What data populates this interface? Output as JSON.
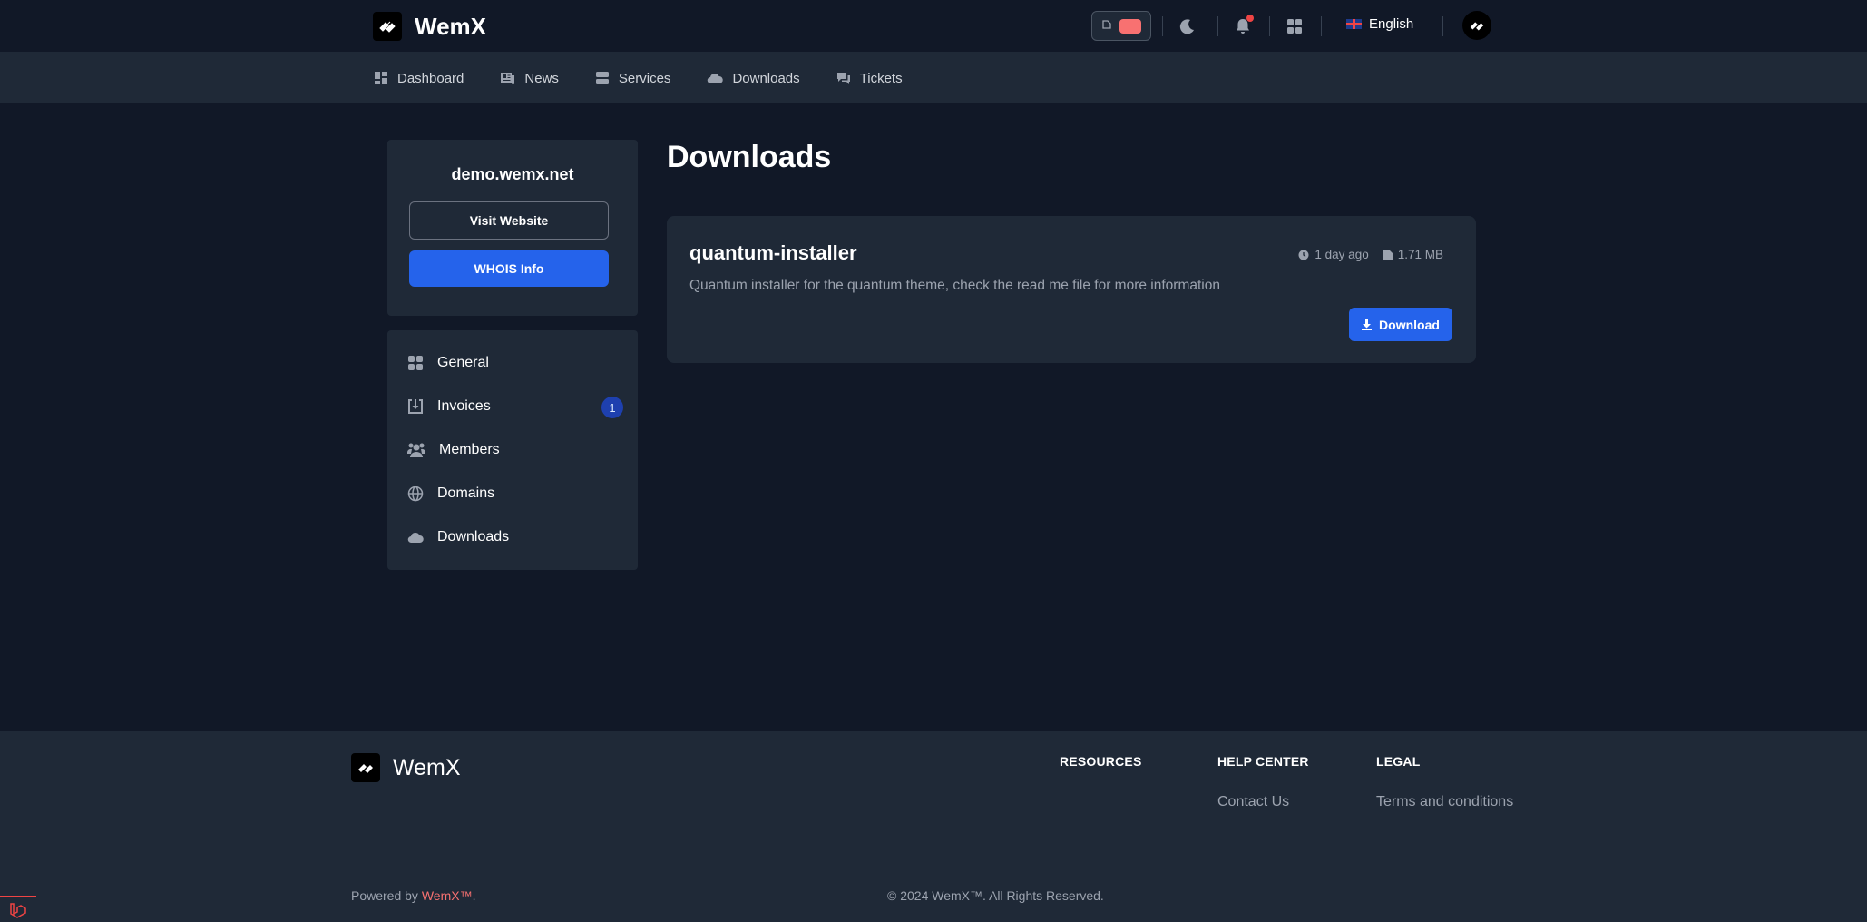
{
  "header": {
    "brand": "WemX",
    "language": "English"
  },
  "nav": {
    "items": [
      {
        "label": "Dashboard",
        "icon": "dashboard-icon"
      },
      {
        "label": "News",
        "icon": "news-icon"
      },
      {
        "label": "Services",
        "icon": "services-icon"
      },
      {
        "label": "Downloads",
        "icon": "cloud-download-icon"
      },
      {
        "label": "Tickets",
        "icon": "tickets-icon"
      }
    ]
  },
  "sidebar": {
    "site": "demo.wemx.net",
    "visit_label": "Visit Website",
    "whois_label": "WHOIS Info",
    "menu": [
      {
        "label": "General",
        "icon": "grid-icon"
      },
      {
        "label": "Invoices",
        "icon": "invoice-icon",
        "badge": "1"
      },
      {
        "label": "Members",
        "icon": "members-icon"
      },
      {
        "label": "Domains",
        "icon": "globe-icon"
      },
      {
        "label": "Downloads",
        "icon": "cloud-download-icon"
      }
    ]
  },
  "main": {
    "title": "Downloads",
    "downloads": [
      {
        "name": "quantum-installer",
        "description": "Quantum installer for the quantum theme, check the read me file for more information",
        "time": "1 day ago",
        "size": "1.71 MB",
        "button": "Download"
      }
    ]
  },
  "footer": {
    "brand": "WemX",
    "columns": [
      {
        "heading": "RESOURCES",
        "links": []
      },
      {
        "heading": "HELP CENTER",
        "links": [
          "Contact Us"
        ]
      },
      {
        "heading": "LEGAL",
        "links": [
          "Terms and conditions"
        ]
      }
    ],
    "powered_prefix": "Powered by ",
    "powered_link": "WemX™",
    "powered_suffix": ".",
    "copyright": "© 2024 WemX™. All Rights Reserved."
  },
  "colors": {
    "background": "#111827",
    "panel": "#1f2937",
    "accent": "#2563eb",
    "notification": "#ef4444"
  }
}
